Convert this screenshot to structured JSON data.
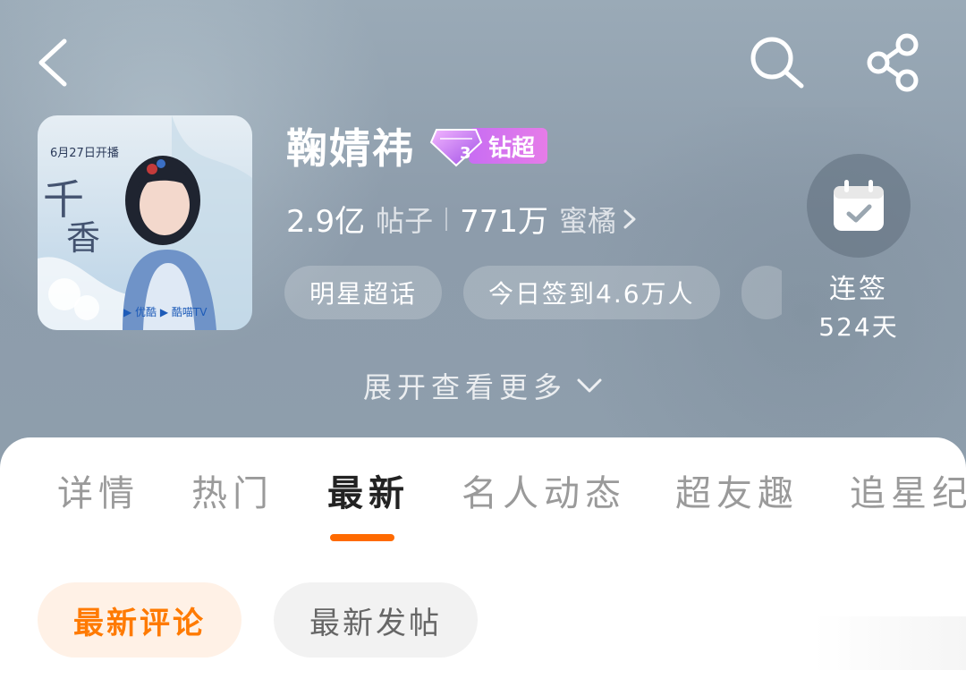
{
  "header": {
    "back_icon": "back-icon",
    "search_icon": "search-icon",
    "share_icon": "share-icon"
  },
  "cover": {
    "date_text": "6月27日开播",
    "title_art": "千香",
    "platforms": [
      "优酷",
      "酷喵TV"
    ]
  },
  "topic": {
    "name": "鞠婧祎",
    "badge_level": "3",
    "badge_label": "钻超",
    "badge_color": "#d46ef0"
  },
  "stats": {
    "posts_value": "2.9亿",
    "posts_label": "帖子",
    "fans_value": "771万",
    "fans_label": "蜜橘"
  },
  "tags": [
    "明星超话",
    "今日签到4.6万人"
  ],
  "checkin": {
    "label": "连签",
    "days": "524天"
  },
  "expand": {
    "label": "展开查看更多"
  },
  "tabs": [
    {
      "label": "详情",
      "active": false
    },
    {
      "label": "热门",
      "active": false
    },
    {
      "label": "最新",
      "active": true
    },
    {
      "label": "名人动态",
      "active": false
    },
    {
      "label": "超友趣",
      "active": false
    },
    {
      "label": "追星纪",
      "active": false
    }
  ],
  "subtabs": [
    {
      "label": "最新评论",
      "active": true
    },
    {
      "label": "最新发帖",
      "active": false
    }
  ],
  "colors": {
    "accent": "#ff6a00",
    "accent_bg": "#fff1e6",
    "hero_bg": "#8e9eac"
  }
}
